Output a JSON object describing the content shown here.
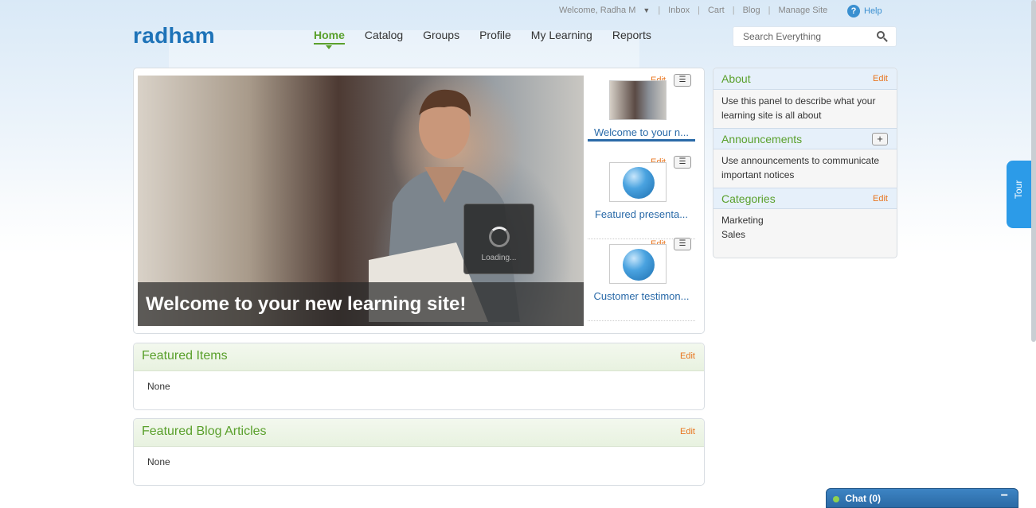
{
  "util": {
    "welcome": "Welcome, Radha M",
    "links": [
      "Inbox",
      "Cart",
      "Blog",
      "Manage Site"
    ],
    "help": "Help"
  },
  "logo": "radham",
  "nav": [
    "Home",
    "Catalog",
    "Groups",
    "Profile",
    "My Learning",
    "Reports"
  ],
  "nav_active": "Home",
  "search": {
    "placeholder": "Search Everything"
  },
  "carousel": {
    "caption": "Welcome to your new learning site!",
    "loading": "Loading...",
    "thumbs": [
      {
        "edit": "Edit",
        "label": "Welcome to your n..."
      },
      {
        "edit": "Edit",
        "label": "Featured presenta..."
      },
      {
        "edit": "Edit",
        "label": "Customer testimon..."
      }
    ]
  },
  "featured_items": {
    "title": "Featured Items",
    "edit": "Edit",
    "body": "None"
  },
  "featured_blog": {
    "title": "Featured Blog Articles",
    "edit": "Edit",
    "body": "None"
  },
  "sidebar": {
    "about": {
      "title": "About",
      "edit": "Edit",
      "body": "Use this panel to describe what your learning site is all about"
    },
    "announcements": {
      "title": "Announcements",
      "plus": "+",
      "body": "Use announcements to communicate important notices"
    },
    "categories": {
      "title": "Categories",
      "edit": "Edit",
      "items": [
        "Marketing",
        "Sales"
      ]
    }
  },
  "tour": "Tour",
  "chat": {
    "label": "Chat",
    "count": "(0)",
    "minimize": "−"
  },
  "colors": {
    "brand": "#1e73b8",
    "accent_green": "#5aa02c",
    "edit_orange": "#e8751f",
    "tour_blue": "#2c9be8"
  }
}
